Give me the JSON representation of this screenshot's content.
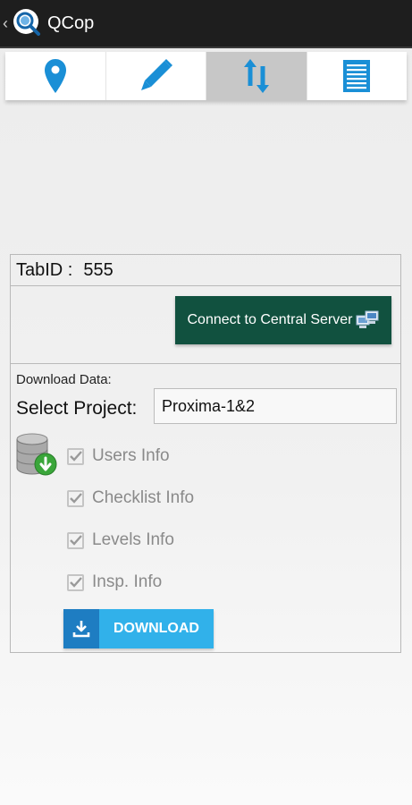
{
  "app": {
    "title": "QCop",
    "icons": {
      "back": "chevron-left-icon",
      "logo": "magnifier-logo-icon"
    }
  },
  "tabs": [
    {
      "icon": "location-pin-icon",
      "active": false
    },
    {
      "icon": "pencil-icon",
      "active": false
    },
    {
      "icon": "sync-arrows-icon",
      "active": true
    },
    {
      "icon": "list-icon",
      "active": false
    }
  ],
  "panel": {
    "tabid_label": "TabID :",
    "tabid_value": "555",
    "connect_label": "Connect to Central Server",
    "download_section_label": "Download Data:",
    "select_project_label": "Select Project:",
    "project_value": "Proxima-1&2",
    "checkboxes": [
      {
        "label": "Users Info",
        "checked": true
      },
      {
        "label": "Checklist Info",
        "checked": true
      },
      {
        "label": "Levels Info",
        "checked": true
      },
      {
        "label": "Insp. Info",
        "checked": true
      }
    ],
    "download_label": "DOWNLOAD"
  },
  "colors": {
    "icon_blue": "#1a8fd6",
    "connect_bg": "#11513f",
    "download_bg": "#31b1ea",
    "download_icon_bg": "#1e7dc2",
    "active_tab": "#c7c7c7",
    "action_bar": "#1e1e1e"
  }
}
